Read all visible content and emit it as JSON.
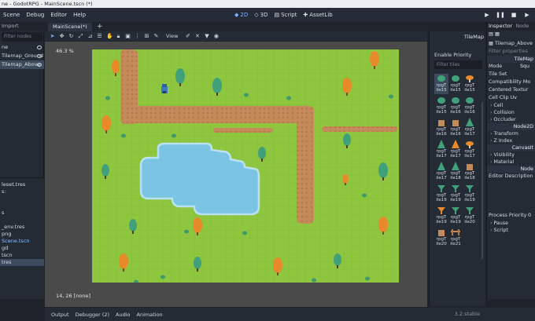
{
  "window": {
    "title": "ne - GodotRPG - MainScene.tscn (*)"
  },
  "menu": {
    "items": [
      "Scene",
      "Debug",
      "Editor",
      "Help"
    ]
  },
  "workspaces": [
    {
      "label": "2D",
      "active": true
    },
    {
      "label": "3D",
      "active": false
    },
    {
      "label": "Script",
      "active": false
    },
    {
      "label": "AssetLib",
      "active": false
    }
  ],
  "scene_dock": {
    "tab": "Import",
    "filter_placeholder": "Filter nodes",
    "nodes": [
      {
        "label": "ne",
        "selected": false
      },
      {
        "label": "Tilemap_Ground",
        "selected": false
      },
      {
        "label": "Tilemap_Above",
        "selected": true
      }
    ]
  },
  "filesystem": {
    "path": "leset.tres",
    "items": [
      {
        "label": "s:",
        "selected": false,
        "blue": false
      },
      {
        "label": "",
        "selected": false,
        "blue": false
      },
      {
        "label": "",
        "selected": false,
        "blue": false
      },
      {
        "label": "s",
        "selected": false,
        "blue": false
      },
      {
        "label": "",
        "selected": false,
        "blue": false
      },
      {
        "label": "_env.tres",
        "selected": false,
        "blue": false
      },
      {
        "label": "png",
        "selected": false,
        "blue": false
      },
      {
        "label": "Scene.tscn",
        "selected": false,
        "blue": true
      },
      {
        "label": "gd",
        "selected": false,
        "blue": false
      },
      {
        "label": "tscn",
        "selected": false,
        "blue": false
      },
      {
        "label": "tres",
        "selected": true,
        "blue": false
      }
    ]
  },
  "editor": {
    "scene_tab": "MainScene(*)",
    "view_label": "View",
    "zoom": "46.3 %",
    "coords": "14, 26 [none]"
  },
  "bottom_bar": {
    "tabs": [
      "Output",
      "Debugger (2)",
      "Audio",
      "Animation"
    ],
    "version": "3.2.stable"
  },
  "palette": {
    "title": "TileMap",
    "enable_priority": "Enable Priority",
    "filter_placeholder": "Filter tiles",
    "tiles": [
      {
        "line1": "rpgT",
        "line2": "ile15",
        "kind": "bush",
        "selected": true
      },
      {
        "line1": "rpgT",
        "line2": "ile15",
        "kind": "bush",
        "selected": false
      },
      {
        "line1": "rpgT",
        "line2": "ile15",
        "kind": "mushroom",
        "selected": false
      },
      {
        "line1": "rpgT",
        "line2": "ile15",
        "kind": "bush",
        "selected": false
      },
      {
        "line1": "rpgT",
        "line2": "ile16",
        "kind": "bush",
        "selected": false
      },
      {
        "line1": "rpgT",
        "line2": "ile16",
        "kind": "bush",
        "selected": false
      },
      {
        "line1": "rpgT",
        "line2": "ile16",
        "kind": "stump",
        "selected": false
      },
      {
        "line1": "rpgT",
        "line2": "ile16",
        "kind": "stump",
        "selected": false
      },
      {
        "line1": "rpgT",
        "line2": "ile17",
        "kind": "tree-green",
        "selected": false
      },
      {
        "line1": "rpgT",
        "line2": "ile17",
        "kind": "tree-green",
        "selected": false
      },
      {
        "line1": "rpgT",
        "line2": "ile17",
        "kind": "tree-orange",
        "selected": false
      },
      {
        "line1": "rpgT",
        "line2": "ile17",
        "kind": "mushroom",
        "selected": false
      },
      {
        "line1": "rpgT",
        "line2": "ile17",
        "kind": "tree-green",
        "selected": false
      },
      {
        "line1": "rpgT",
        "line2": "ile18",
        "kind": "tree-green",
        "selected": false
      },
      {
        "line1": "rpgT",
        "line2": "ile18",
        "kind": "stump",
        "selected": false
      },
      {
        "line1": "rpgT",
        "line2": "ile19",
        "kind": "palm-green",
        "selected": false
      },
      {
        "line1": "rpgT",
        "line2": "ile19",
        "kind": "palm-green",
        "selected": false
      },
      {
        "line1": "rpgT",
        "line2": "ile19",
        "kind": "palm-green",
        "selected": false
      },
      {
        "line1": "rpgT",
        "line2": "ile19",
        "kind": "palm-orange",
        "selected": false
      },
      {
        "line1": "rpgT",
        "line2": "ile19",
        "kind": "palm-green",
        "selected": false
      },
      {
        "line1": "rpgT",
        "line2": "ile20",
        "kind": "palm-green",
        "selected": false
      },
      {
        "line1": "rpgT",
        "line2": "ile20",
        "kind": "stump",
        "selected": false
      },
      {
        "line1": "rpgT",
        "line2": "ile21",
        "kind": "fence",
        "selected": false
      }
    ]
  },
  "inspector": {
    "tabs": [
      "Inspector",
      "Node"
    ],
    "node_label": "Tilemap_Above",
    "filter_placeholder": "Filter properties",
    "head": "TileMap",
    "rows": [
      {
        "label": "Mode",
        "value": "Squ"
      },
      {
        "label": "Tile Set",
        "value": ""
      },
      {
        "label": "Compatibility Mo",
        "value": ""
      },
      {
        "label": "Centered Textur",
        "value": ""
      },
      {
        "label": "Cell Clip Uv",
        "value": ""
      }
    ],
    "sections": [
      "Cell",
      "Collision",
      "Occluder"
    ],
    "head2": "Node2D",
    "sections2": [
      "Transform",
      "Z Index"
    ],
    "head3": "CanvasIt",
    "sections3": [
      "Visibility",
      "Material"
    ],
    "head4": "Node",
    "editor_description": "Editor Description",
    "process_priority_label": "Process Priority",
    "process_priority_value": "0",
    "sections4": [
      "Pause",
      "Script"
    ]
  },
  "colors": {
    "grass": "#8ec63f",
    "path": "#c58a5a",
    "water": "#7cc4e4",
    "tree_green": "#3fa07a",
    "tree_orange": "#e88a2a"
  }
}
